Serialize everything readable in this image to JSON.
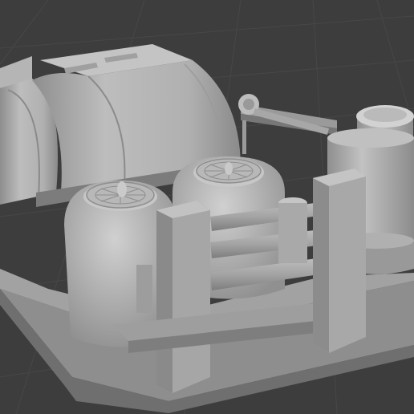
{
  "app": {
    "view": "3d-viewport",
    "shading": "solid"
  },
  "colors": {
    "background": "#3d3d3d",
    "grid_line": "#474747",
    "model_light": "#c8c8c8",
    "model_mid": "#a9a9a9",
    "model_dark": "#7e7e7e",
    "model_shadow": "#5f5f5f"
  },
  "scene": {
    "grid": true,
    "objects": [
      "base-plate",
      "curved-hood-left",
      "curved-hood-right",
      "canister-left",
      "canister-right",
      "fan-left",
      "fan-right",
      "pipe-rack",
      "tall-cylinder-tank",
      "lever-arm"
    ]
  }
}
